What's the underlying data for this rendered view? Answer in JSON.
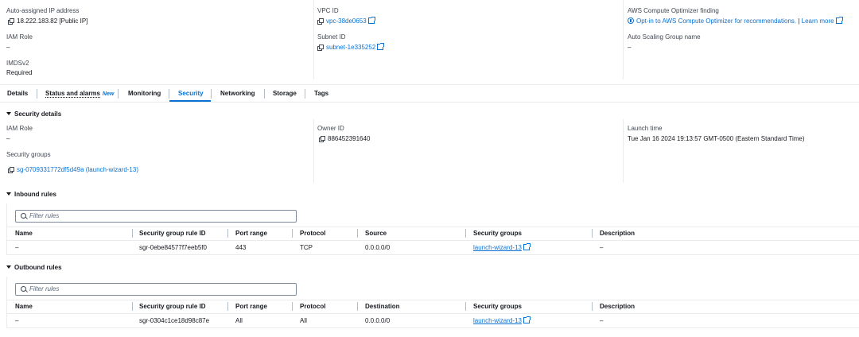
{
  "summary": {
    "public_ip_label": "Auto-assigned IP address",
    "public_ip_value": "18.222.183.82 [Public IP]",
    "iam_role_label": "IAM Role",
    "iam_role_value": "–",
    "imds_label": "IMDSv2",
    "imds_value": "Required",
    "vpc_label": "VPC ID",
    "vpc_value": "vpc-38de0653",
    "subnet_label": "Subnet ID",
    "subnet_value": "subnet-1e335252",
    "optimizer_label": "AWS Compute Optimizer finding",
    "optimizer_link": "Opt-in to AWS Compute Optimizer for recommendations.",
    "optimizer_sep": "|",
    "learn_more": "Learn more",
    "asg_label": "Auto Scaling Group name",
    "asg_value": "–"
  },
  "tabs": [
    {
      "label": "Details"
    },
    {
      "label": "Status and alarms",
      "badge": "New"
    },
    {
      "label": "Monitoring"
    },
    {
      "label": "Security",
      "active": true
    },
    {
      "label": "Networking"
    },
    {
      "label": "Storage"
    },
    {
      "label": "Tags"
    }
  ],
  "security_details": {
    "title": "Security details",
    "iam_role_label": "IAM Role",
    "iam_role_value": "–",
    "owner_label": "Owner ID",
    "owner_value": "886452391640",
    "launch_label": "Launch time",
    "launch_value": "Tue Jan 16 2024 19:13:57 GMT-0500 (Eastern Standard Time)",
    "sg_label": "Security groups",
    "sg_value": "sg-0709331772df5d49a (launch-wizard-13)"
  },
  "inbound": {
    "title": "Inbound rules",
    "filter_placeholder": "Filter rules",
    "headers": [
      "Name",
      "Security group rule ID",
      "Port range",
      "Protocol",
      "Source",
      "Security groups",
      "Description"
    ],
    "row": [
      "–",
      "sgr-0ebe84577f7eeb5f0",
      "443",
      "TCP",
      "0.0.0.0/0",
      "launch-wizard-13",
      "–"
    ]
  },
  "outbound": {
    "title": "Outbound rules",
    "filter_placeholder": "Filter rules",
    "headers": [
      "Name",
      "Security group rule ID",
      "Port range",
      "Protocol",
      "Destination",
      "Security groups",
      "Description"
    ],
    "row": [
      "–",
      "sgr-0304c1ce18d98c87e",
      "All",
      "All",
      "0.0.0.0/0",
      "launch-wizard-13",
      "–"
    ]
  },
  "colors": {
    "link": "#0972d3",
    "text": "#16191f",
    "active_tab": "#0972d3"
  }
}
